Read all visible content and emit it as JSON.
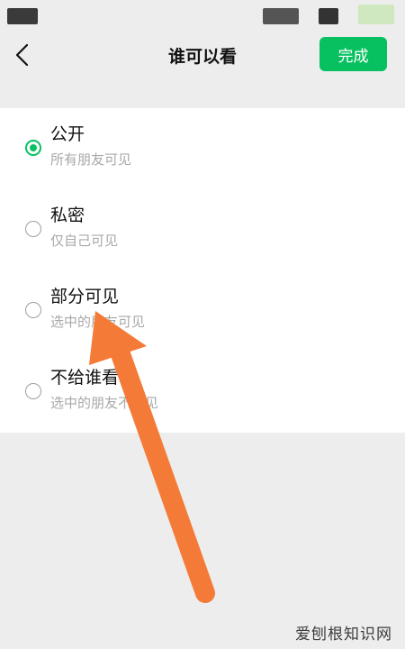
{
  "nav": {
    "title": "谁可以看",
    "done_label": "完成",
    "accent_color": "#07c160"
  },
  "options": [
    {
      "title": "公开",
      "subtitle": "所有朋友可见",
      "selected": true
    },
    {
      "title": "私密",
      "subtitle": "仅自己可见",
      "selected": false
    },
    {
      "title": "部分可见",
      "subtitle": "选中的朋友可见",
      "selected": false
    },
    {
      "title": "不给谁看",
      "subtitle": "选中的朋友不可见",
      "selected": false
    }
  ],
  "annotation": {
    "color": "#f47b37"
  },
  "watermark": "爱刨根知识网"
}
